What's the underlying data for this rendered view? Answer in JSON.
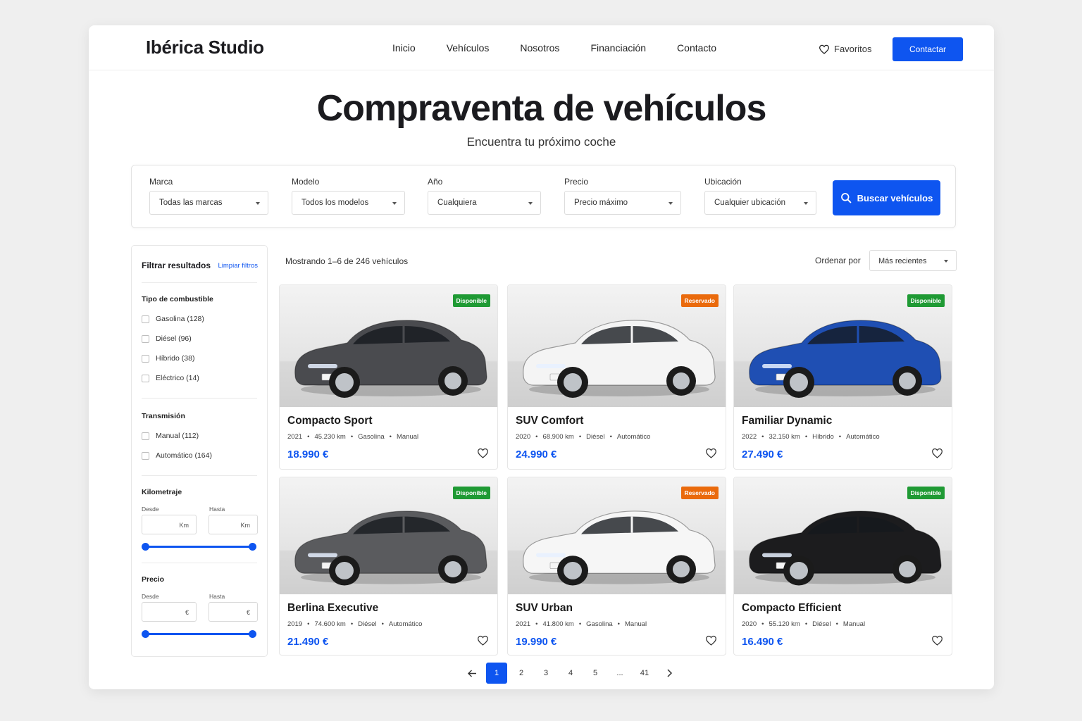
{
  "brand": "Ibérica Studio",
  "nav": [
    "Inicio",
    "Vehículos",
    "Nosotros",
    "Financiación",
    "Contacto"
  ],
  "header": {
    "favorites": "Favoritos",
    "contact": "Contactar"
  },
  "hero": {
    "title": "Compraventa de vehículos",
    "subtitle": "Encuentra tu próximo coche"
  },
  "search": {
    "fields": [
      {
        "label": "Marca",
        "value": "Todas las marcas"
      },
      {
        "label": "Modelo",
        "value": "Todos los modelos"
      },
      {
        "label": "Año",
        "value": "Cualquiera"
      },
      {
        "label": "Precio",
        "value": "Precio máximo"
      },
      {
        "label": "Ubicación",
        "value": "Cualquier ubicación"
      }
    ],
    "button": "Buscar vehículos"
  },
  "filters": {
    "title": "Filtrar resultados",
    "clear": "Limpiar filtros",
    "fuel": {
      "heading": "Tipo de combustible",
      "options": [
        "Gasolina (128)",
        "Diésel (96)",
        "Híbrido (38)",
        "Eléctrico (14)"
      ]
    },
    "transmission": {
      "heading": "Transmisión",
      "options": [
        "Manual (112)",
        "Automático (164)"
      ]
    },
    "mileage": {
      "heading": "Kilometraje",
      "from": "Desde",
      "to": "Hasta",
      "unit": "Km"
    },
    "price": {
      "heading": "Precio",
      "from": "Desde",
      "to": "Hasta",
      "unit": "€"
    }
  },
  "results": {
    "count": "Mostrando 1–6 de 246 vehículos",
    "sort_label": "Ordenar por",
    "sort_value": "Más recientes"
  },
  "cars": [
    {
      "name": "Compacto Sport",
      "year": "2021",
      "km": "45.230 km",
      "fuel": "Gasolina",
      "gear": "Manual",
      "price": "18.990 €",
      "status": "Disponible",
      "color": "#4a4b4f"
    },
    {
      "name": "SUV Comfort",
      "year": "2020",
      "km": "68.900 km",
      "fuel": "Diésel",
      "gear": "Automático",
      "price": "24.990 €",
      "status": "Reservado",
      "color": "#f4f4f4"
    },
    {
      "name": "Familiar Dynamic",
      "year": "2022",
      "km": "32.150 km",
      "fuel": "Híbrido",
      "gear": "Automático",
      "price": "27.490 €",
      "status": "Disponible",
      "color": "#1f4fb3"
    },
    {
      "name": "Berlina Executive",
      "year": "2019",
      "km": "74.600 km",
      "fuel": "Diésel",
      "gear": "Automático",
      "price": "21.490 €",
      "status": "Disponible",
      "color": "#5a5b5e"
    },
    {
      "name": "SUV Urban",
      "year": "2021",
      "km": "41.800 km",
      "fuel": "Gasolina",
      "gear": "Manual",
      "price": "19.990 €",
      "status": "Reservado",
      "color": "#f6f6f6"
    },
    {
      "name": "Compacto Efficient",
      "year": "2020",
      "km": "55.120 km",
      "fuel": "Diésel",
      "gear": "Manual",
      "price": "16.490 €",
      "status": "Disponible",
      "color": "#1c1c1e"
    }
  ],
  "pagination": {
    "pages": [
      "1",
      "2",
      "3",
      "4",
      "5",
      "...",
      "41"
    ],
    "current": "1"
  },
  "colors": {
    "accent": "#0e55f0",
    "available": "#1f9a34",
    "reserved": "#ea6a0c"
  }
}
